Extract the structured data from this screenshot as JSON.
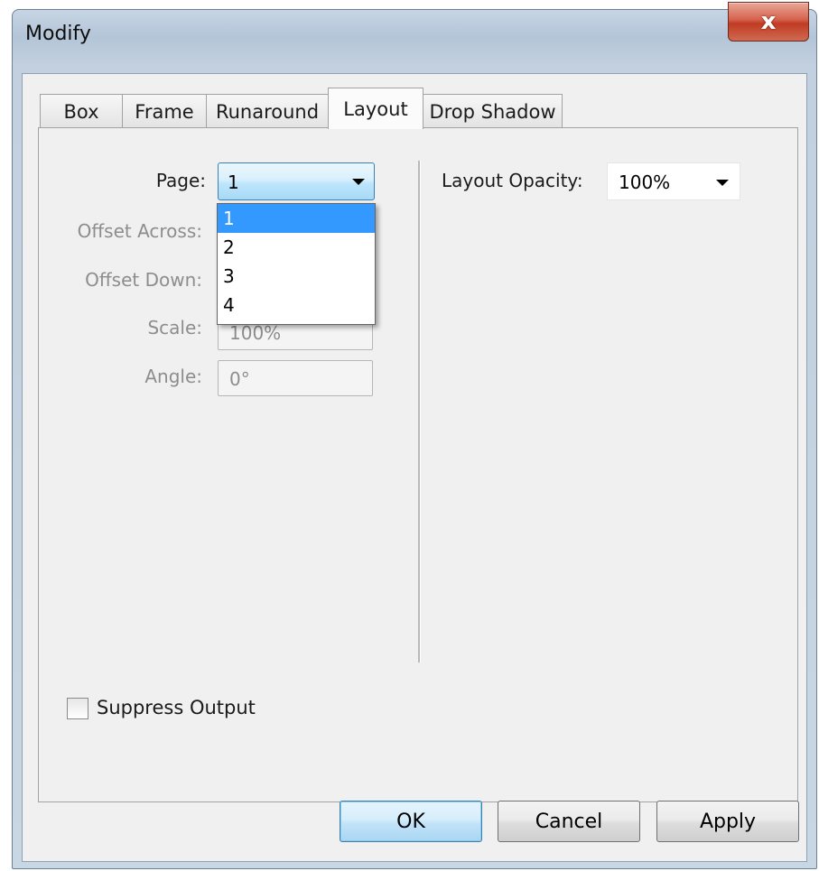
{
  "window": {
    "title": "Modify",
    "close_glyph": "x"
  },
  "tabs": [
    {
      "label": "Box",
      "active": false
    },
    {
      "label": "Frame",
      "active": false
    },
    {
      "label": "Runaround",
      "active": false
    },
    {
      "label": "Layout",
      "active": true
    },
    {
      "label": "Drop Shadow",
      "active": false
    }
  ],
  "layout": {
    "page_label": "Page:",
    "page_value": "1",
    "page_options": [
      "1",
      "2",
      "3",
      "4"
    ],
    "offset_across_label": "Offset Across:",
    "offset_down_label": "Offset Down:",
    "scale_label": "Scale:",
    "scale_value": "100%",
    "angle_label": "Angle:",
    "angle_value": "0°",
    "opacity_label": "Layout Opacity:",
    "opacity_value": "100%",
    "suppress_label": "Suppress Output",
    "suppress_checked": false
  },
  "buttons": {
    "ok": "OK",
    "cancel": "Cancel",
    "apply": "Apply"
  },
  "colors": {
    "selection": "#3399ff",
    "close_button": "#c13b22"
  }
}
